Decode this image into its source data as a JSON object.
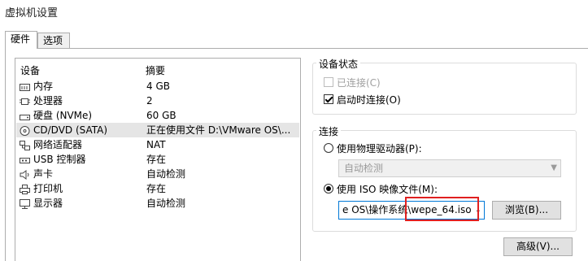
{
  "window": {
    "title": "虚拟机设置"
  },
  "tabs": [
    {
      "label": "硬件",
      "active": true
    },
    {
      "label": "选项",
      "active": false
    }
  ],
  "device_list": {
    "columns": [
      "设备",
      "摘要"
    ],
    "rows": [
      {
        "device": "内存",
        "summary": "4 GB",
        "icon": "memory-icon",
        "selected": false
      },
      {
        "device": "处理器",
        "summary": "2",
        "icon": "cpu-icon",
        "selected": false
      },
      {
        "device": "硬盘 (NVMe)",
        "summary": "60 GB",
        "icon": "hard-disk-icon",
        "selected": false
      },
      {
        "device": "CD/DVD (SATA)",
        "summary": "正在使用文件 D:\\VMware OS\\...",
        "icon": "cd-dvd-icon",
        "selected": true
      },
      {
        "device": "网络适配器",
        "summary": "NAT",
        "icon": "network-adapter-icon",
        "selected": false
      },
      {
        "device": "USB 控制器",
        "summary": "存在",
        "icon": "usb-icon",
        "selected": false
      },
      {
        "device": "声卡",
        "summary": "自动检测",
        "icon": "speaker-icon",
        "selected": false
      },
      {
        "device": "打印机",
        "summary": "存在",
        "icon": "printer-icon",
        "selected": false
      },
      {
        "device": "显示器",
        "summary": "自动检测",
        "icon": "monitor-icon",
        "selected": false
      }
    ]
  },
  "device_status": {
    "legend": "设备状态",
    "connected_label": "已连接(C)",
    "connected_checked": false,
    "connected_enabled": false,
    "connect_on_power_label": "启动时连接(O)",
    "connect_on_power_checked": true
  },
  "connection": {
    "legend": "连接",
    "physical_drive_label": "使用物理驱动器(P):",
    "physical_drive_selected": false,
    "physical_drive_value": "自动检测",
    "iso_label": "使用 ISO 映像文件(M):",
    "iso_selected": true,
    "iso_path_visible_prefix": "e OS\\操作系统\\",
    "iso_path_visible_highlighted": "wepe_64.iso",
    "browse_label": "浏览(B)..."
  },
  "advanced_label": "高级(V)...",
  "colors": {
    "selection_row": "#e5e5e5",
    "focus_border": "#0078d7",
    "highlight_annotation": "#e02020"
  }
}
